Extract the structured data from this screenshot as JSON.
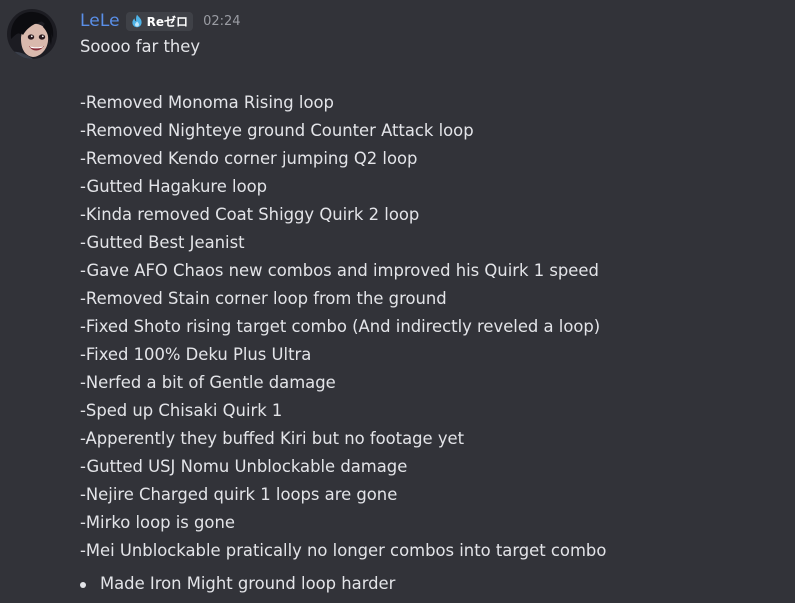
{
  "message": {
    "author": "LeLe",
    "tag": {
      "icon": "flame-icon",
      "text": "Reゼロ"
    },
    "timestamp": "02:24",
    "intro": "Soooo far they",
    "lines": [
      "-Removed Monoma Rising loop",
      "-Removed Nighteye ground Counter Attack loop",
      "-Removed Kendo corner jumping Q2 loop",
      "-Gutted Hagakure loop",
      "-Kinda removed Coat Shiggy Quirk 2 loop",
      "-Gutted Best Jeanist",
      "-Gave AFO Chaos new combos and improved his Quirk 1 speed",
      "-Removed Stain corner loop from the ground",
      "-Fixed Shoto rising target combo (And indirectly reveled a loop)",
      "-Fixed 100% Deku Plus Ultra",
      "-Nerfed a bit of Gentle damage",
      "-Sped up Chisaki Quirk 1",
      "-Apperently they buffed Kiri but no footage yet",
      "-Gutted USJ Nomu Unblockable damage",
      "-Nejire Charged quirk 1 loops are gone",
      "-Mirko loop is gone",
      "-Mei Unblockable pratically no longer combos into target combo"
    ],
    "bullets": [
      "Made Iron Might ground loop harder"
    ]
  },
  "colors": {
    "background": "#323339",
    "username": "#5a8fe8",
    "text": "#e3e4e8",
    "timestamp": "#9a9ca3",
    "tag_bg": "#3f4147",
    "tag_icon": "#4fb4e8"
  }
}
